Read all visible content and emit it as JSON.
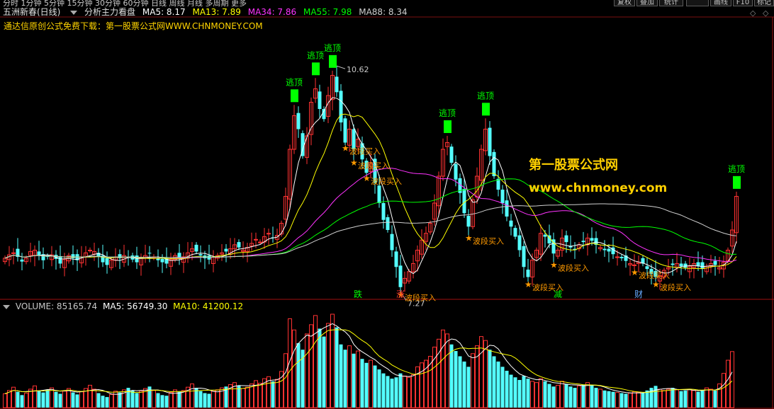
{
  "toolbar": {
    "left_text": "分时 1分钟 5分钟 15分钟 30分钟 60分钟 日线 周线 月线 多周期 更多",
    "buttons": [
      "复权",
      "叠加",
      "统计",
      "",
      "画线",
      "F10",
      "标记"
    ]
  },
  "header": {
    "stock": "五洲新春(日线)",
    "indicator": "分析主力看盘",
    "ma": [
      {
        "label": "MA5: 8.17",
        "color": "#ffffff"
      },
      {
        "label": "MA13: 7.89",
        "color": "#ffff00"
      },
      {
        "label": "MA34: 7.86",
        "color": "#ff33ff"
      },
      {
        "label": "MA55: 7.98",
        "color": "#00ff00"
      },
      {
        "label": "MA88: 8.34",
        "color": "#d0d0d0"
      }
    ]
  },
  "promo": "通达信原创公式免费下载：第一股票公式网WWW.CHNMONEY.COM",
  "watermark": {
    "line1": "第一股票公式网",
    "line2": "www.chnmoney.com"
  },
  "volume_header": {
    "title": "VOLUME: 85165.74",
    "ma5": "MA5: 56749.30",
    "ma10": "MA10: 41200.12",
    "colors": {
      "title": "#c8c8c8",
      "ma5": "#ffffff",
      "ma10": "#ffff00"
    }
  },
  "chart_data": {
    "type": "candlestick",
    "price_range": [
      7.0,
      11.0
    ],
    "colors": {
      "up": "#ff3232",
      "down": "#54ffff",
      "ma5": "#ffffff",
      "ma13": "#ffff00",
      "ma34": "#ff33ff",
      "ma55": "#00ff00",
      "ma88": "#d0d0d0",
      "signal_top": "#00ff00",
      "signal_buy": "#ff9a00",
      "label": "#ffd400"
    },
    "high_label": "10.62",
    "low_label": "7.27",
    "escape_label": "逃顶",
    "buy_label": "波段买入",
    "markers": [
      "跌",
      "涨",
      "减",
      "财"
    ],
    "marker_colors": [
      "#00ff00",
      "#ff3333",
      "#00ff00",
      "#66aaff"
    ],
    "close": [
      7.58,
      7.63,
      7.66,
      7.6,
      7.53,
      7.58,
      7.68,
      7.7,
      7.62,
      7.55,
      7.6,
      7.63,
      7.57,
      7.5,
      7.56,
      7.62,
      7.58,
      7.55,
      7.6,
      7.66,
      7.7,
      7.68,
      7.6,
      7.52,
      7.48,
      7.55,
      7.6,
      7.58,
      7.62,
      7.6,
      7.56,
      7.52,
      7.58,
      7.62,
      7.65,
      7.6,
      7.55,
      7.52,
      7.5,
      7.56,
      7.62,
      7.58,
      7.6,
      7.66,
      7.72,
      7.68,
      7.62,
      7.58,
      7.56,
      7.6,
      7.62,
      7.66,
      7.68,
      7.72,
      7.78,
      7.74,
      7.7,
      7.74,
      7.8,
      7.86,
      7.82,
      7.9,
      7.95,
      7.88,
      7.92,
      8.1,
      8.5,
      9.2,
      9.7,
      9.5,
      9.1,
      9.4,
      9.9,
      10.1,
      9.8,
      9.65,
      10.0,
      10.3,
      10.05,
      9.6,
      9.3,
      9.5,
      9.2,
      9.35,
      9.05,
      8.85,
      9.0,
      8.7,
      8.4,
      8.15,
      8.0,
      7.7,
      7.45,
      7.15,
      7.28,
      7.38,
      7.5,
      7.7,
      7.85,
      7.95,
      8.1,
      8.4,
      8.8,
      9.2,
      9.3,
      9.0,
      8.75,
      8.55,
      8.25,
      8.05,
      8.45,
      8.8,
      9.2,
      9.5,
      9.1,
      8.8,
      8.6,
      8.4,
      8.2,
      8.05,
      7.9,
      7.7,
      7.45,
      7.3,
      7.55,
      7.7,
      7.95,
      7.9,
      7.8,
      7.65,
      7.7,
      7.88,
      7.82,
      7.74,
      7.7,
      7.78,
      7.82,
      7.88,
      7.84,
      7.78,
      7.74,
      7.7,
      7.68,
      7.64,
      7.6,
      7.58,
      7.54,
      7.5,
      7.48,
      7.52,
      7.5,
      7.42,
      7.35,
      7.3,
      7.32,
      7.4,
      7.44,
      7.48,
      7.5,
      7.46,
      7.44,
      7.46,
      7.5,
      7.46,
      7.42,
      7.46,
      7.5,
      7.48,
      7.44,
      7.52,
      7.7,
      8.0,
      8.5
    ],
    "volume": [
      21000,
      26000,
      31000,
      24000,
      19000,
      22000,
      28000,
      33000,
      26000,
      23000,
      27000,
      30000,
      24000,
      21000,
      25000,
      29000,
      23000,
      20000,
      24000,
      29000,
      34000,
      28000,
      22000,
      18000,
      16000,
      20000,
      25000,
      23000,
      27000,
      30000,
      26000,
      22000,
      25000,
      29000,
      32000,
      26000,
      22000,
      19000,
      18000,
      23000,
      27000,
      24000,
      26000,
      31000,
      36000,
      30000,
      25000,
      22000,
      21000,
      25000,
      27000,
      30000,
      32000,
      35000,
      38000,
      33000,
      29000,
      31000,
      36000,
      41000,
      37000,
      44000,
      47000,
      40000,
      43000,
      55000,
      82000,
      135000,
      118000,
      98000,
      88000,
      112000,
      126000,
      140000,
      120000,
      108000,
      128000,
      142000,
      122000,
      96000,
      88000,
      94000,
      82000,
      86000,
      74000,
      68000,
      72000,
      64000,
      58000,
      52000,
      48000,
      44000,
      46000,
      52000,
      48000,
      46000,
      50000,
      62000,
      68000,
      72000,
      78000,
      92000,
      104000,
      118000,
      112000,
      96000,
      86000,
      78000,
      70000,
      62000,
      82000,
      94000,
      108000,
      102000,
      88000,
      78000,
      70000,
      62000,
      56000,
      50000,
      46000,
      42000,
      48000,
      44000,
      40000,
      38000,
      44000,
      40000,
      36000,
      32000,
      34000,
      40000,
      36000,
      32000,
      30000,
      33000,
      35000,
      38000,
      34000,
      30000,
      28000,
      26000,
      25000,
      24000,
      23000,
      22000,
      21000,
      22000,
      24000,
      23000,
      22000,
      26000,
      30000,
      33000,
      28000,
      26000,
      28000,
      30000,
      27000,
      25000,
      26000,
      28000,
      26000,
      24000,
      26000,
      30000,
      28000,
      26000,
      36000,
      52000,
      72000,
      85165
    ]
  }
}
